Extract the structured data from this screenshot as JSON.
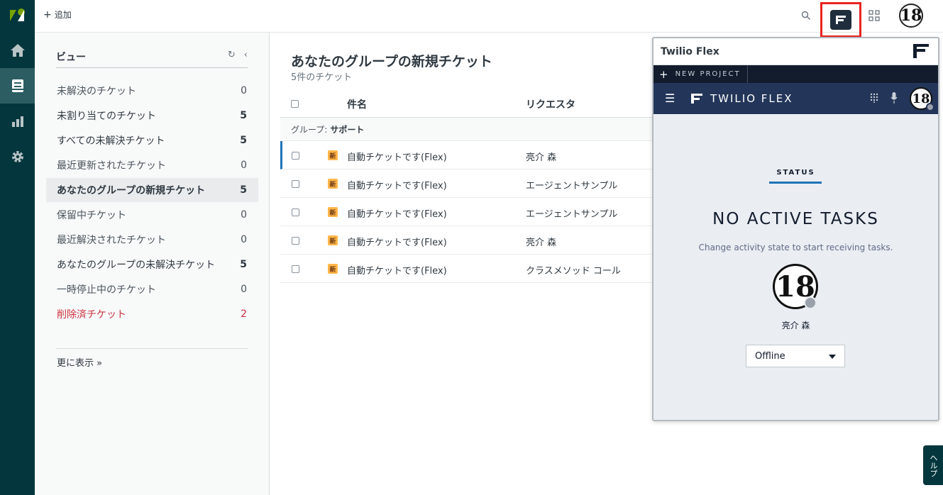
{
  "topbar": {
    "add_label": "追加"
  },
  "views": {
    "title": "ビュー",
    "items": [
      {
        "label": "未解決のチケット",
        "count": "0"
      },
      {
        "label": "未割り当てのチケット",
        "count": "5"
      },
      {
        "label": "すべての未解決チケット",
        "count": "5"
      },
      {
        "label": "最近更新されたチケット",
        "count": "0"
      },
      {
        "label": "あなたのグループの新規チケット",
        "count": "5"
      },
      {
        "label": "保留中チケット",
        "count": "0"
      },
      {
        "label": "最近解決されたチケット",
        "count": "0"
      },
      {
        "label": "あなたのグループの未解決チケット",
        "count": "5"
      },
      {
        "label": "一時停止中のチケット",
        "count": "0"
      },
      {
        "label": "削除済チケット",
        "count": "2"
      }
    ],
    "more_label": "更に表示 »"
  },
  "main": {
    "title": "あなたのグループの新規チケット",
    "subtitle": "5件のチケット",
    "columns": {
      "subject": "件名",
      "requester": "リクエスタ"
    },
    "group_label": "グループ:",
    "group_name": "サポート",
    "rows": [
      {
        "badge": "新",
        "subject": "自動チケットです(Flex)",
        "requester": "亮介 森"
      },
      {
        "badge": "新",
        "subject": "自動チケットです(Flex)",
        "requester": "エージェントサンプル"
      },
      {
        "badge": "新",
        "subject": "自動チケットです(Flex)",
        "requester": "エージェントサンプル"
      },
      {
        "badge": "新",
        "subject": "自動チケットです(Flex)",
        "requester": "亮介 森"
      },
      {
        "badge": "新",
        "subject": "自動チケットです(Flex)",
        "requester": "クラスメソッド コール"
      }
    ]
  },
  "flex": {
    "panel_title": "Twilio Flex",
    "project_label": "NEW PROJECT",
    "brand": "TWILIO FLEX",
    "status_label": "STATUS",
    "no_tasks": "NO ACTIVE TASKS",
    "hint": "Change activity state to start receiving tasks.",
    "agent_name": "亮介 森",
    "activity": "Offline",
    "avatar_text": "18"
  },
  "help_label": "ヘルプ",
  "colors": {
    "nav_bg": "#03363d",
    "flex_nav": "#233659",
    "highlight": "#e8231f",
    "deleted": "#cc3340",
    "badge": "#ffb648"
  }
}
